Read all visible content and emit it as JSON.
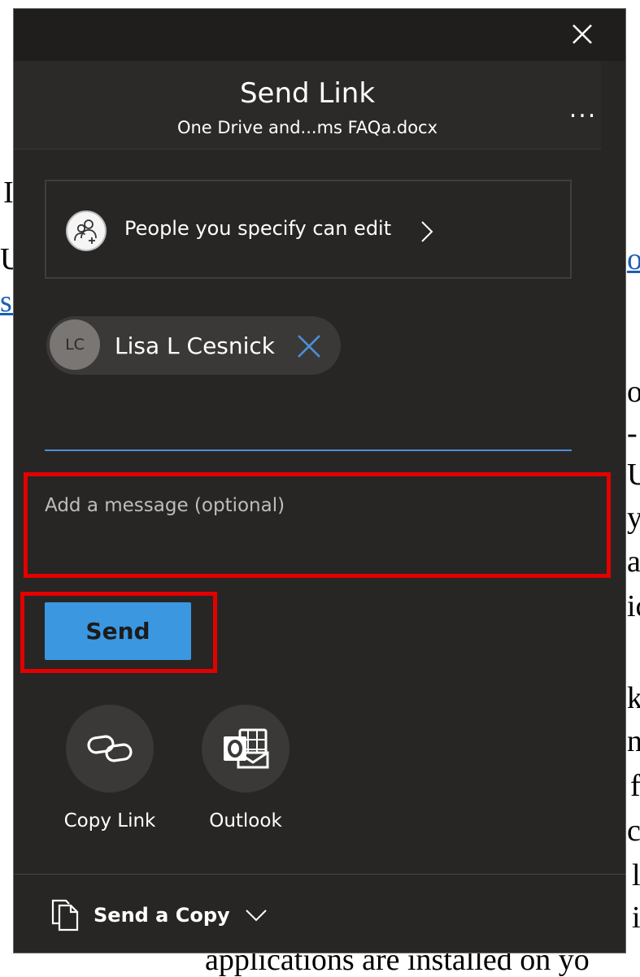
{
  "background_document": {
    "fragments": [
      "I",
      "U",
      "sa",
      "o",
      "on",
      "-",
      "U",
      "y",
      "a",
      "ic",
      "ks",
      "ne",
      "f",
      "c",
      "l",
      "i"
    ],
    "bottom_line": "applications are installed on yo"
  },
  "dialog": {
    "title": "Send Link",
    "subtitle": "One Drive and...ms FAQa.docx",
    "more_label": "...",
    "permission": {
      "label": "People you specify can edit"
    },
    "recipients": [
      {
        "initials": "LC",
        "name": "Lisa L Cesnick"
      }
    ],
    "recipient_input": {
      "value": "",
      "placeholder": ""
    },
    "message": {
      "value": "",
      "placeholder": "Add a message (optional)"
    },
    "send_label": "Send",
    "share_options": [
      {
        "label": "Copy Link",
        "icon": "link-icon"
      },
      {
        "label": "Outlook",
        "icon": "outlook-icon"
      }
    ],
    "footer": {
      "label": "Send a Copy",
      "icon": "copy-document-icon"
    }
  },
  "colors": {
    "dialog_bg": "#272624",
    "accent_blue": "#3b97e0",
    "highlight_red": "#e30000"
  }
}
